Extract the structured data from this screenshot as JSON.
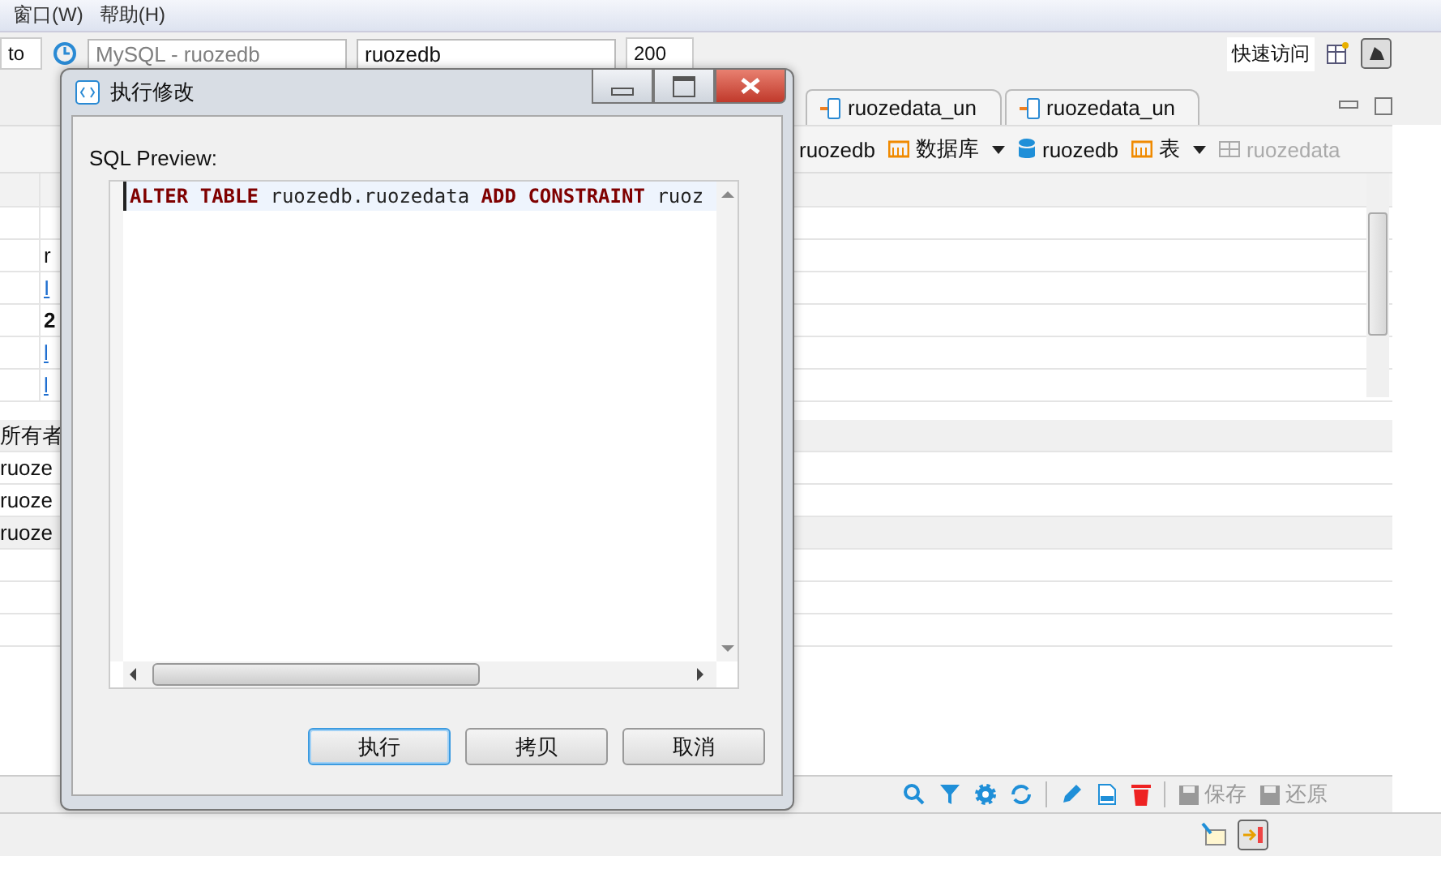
{
  "menu": [
    "窗口(W)",
    "帮助(H)"
  ],
  "toolbar": {
    "field": "to",
    "connection": "MySQL - ruozedb",
    "database": "ruozedb",
    "limit": "200",
    "quick_access": "快速访问"
  },
  "tabs": [
    {
      "label": "ruozedata_un"
    },
    {
      "label": "ruozedata_un"
    }
  ],
  "breadcrumb": [
    {
      "label": "ruozedb",
      "kind": "text",
      "disabled": false
    },
    {
      "label": "数据库",
      "kind": "folder",
      "disabled": false
    },
    {
      "label": "ruozedb",
      "kind": "database",
      "disabled": false
    },
    {
      "label": "表",
      "kind": "folder",
      "disabled": false
    },
    {
      "label": "ruozedata",
      "kind": "table",
      "disabled": true
    }
  ],
  "properties": {
    "rows": [
      {
        "value": "r",
        "kind": "text"
      },
      {
        "value": "I",
        "kind": "link"
      },
      {
        "value": "2",
        "kind": "bold"
      },
      {
        "value": "l",
        "kind": "link"
      },
      {
        "value": "l",
        "kind": "link"
      }
    ]
  },
  "owners": {
    "header": "所有者",
    "rows": [
      "ruoze",
      "ruoze",
      "ruoze"
    ]
  },
  "actions": [
    {
      "label": "保存",
      "disabled": true
    },
    {
      "label": "还原",
      "disabled": true
    }
  ],
  "dialog": {
    "title": "执行修改",
    "label": "SQL Preview:",
    "sql": [
      {
        "text": "ALTER",
        "kind": "keyword"
      },
      {
        "text": "TABLE",
        "kind": "keyword"
      },
      {
        "text": "ruozedb.ruozedata",
        "kind": "plain"
      },
      {
        "text": "ADD",
        "kind": "keyword"
      },
      {
        "text": "CONSTRAINT",
        "kind": "keyword"
      },
      {
        "text": "ruoz",
        "kind": "plain"
      }
    ],
    "buttons": [
      {
        "label": "执行",
        "selected": true
      },
      {
        "label": "拷贝",
        "selected": false
      },
      {
        "label": "取消",
        "selected": false
      }
    ]
  }
}
